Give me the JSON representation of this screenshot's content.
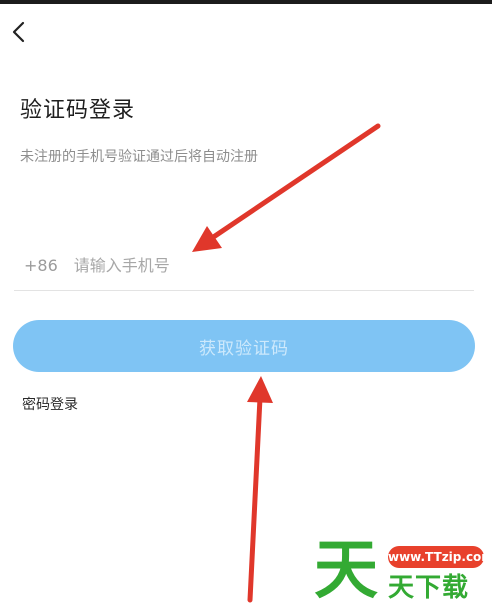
{
  "header": {
    "back_icon": "chevron-left-icon"
  },
  "login": {
    "title": "验证码登录",
    "subtitle": "未注册的手机号验证通过后将自动注册",
    "country_code": "+86",
    "phone_placeholder": "请输入手机号",
    "get_code_label": "获取验证码",
    "password_login_label": "密码登录"
  },
  "colors": {
    "button_bg": "#7fc4f4",
    "button_text": "#cde9fc",
    "arrow": "#e0372b",
    "watermark_green": "#33aa33",
    "watermark_red": "#e8412c"
  },
  "watermark": {
    "glyph": "天",
    "url": "www.TTzip.com",
    "text": "天下载"
  }
}
